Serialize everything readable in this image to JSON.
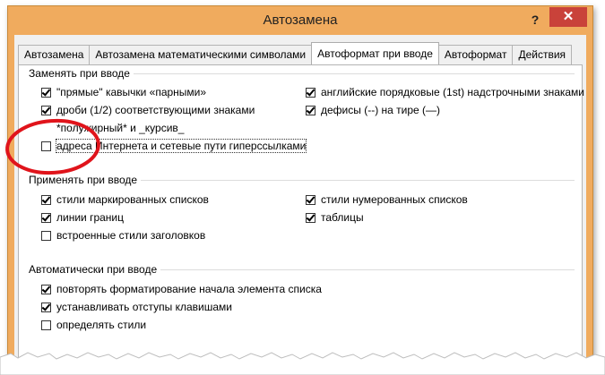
{
  "window": {
    "title": "Автозамена",
    "help": "?",
    "close": "✕"
  },
  "tabs": [
    {
      "label": "Автозамена",
      "active": false
    },
    {
      "label": "Автозамена математическими символами",
      "active": false
    },
    {
      "label": "Автоформат при вводе",
      "active": true
    },
    {
      "label": "Автоформат",
      "active": false
    },
    {
      "label": "Действия",
      "active": false
    }
  ],
  "replace_group": {
    "title": "Заменять при вводе",
    "left": [
      {
        "label": "\"прямые\" кавычки «парными»",
        "checked": true
      },
      {
        "label": "дроби (1/2) соответствующими знаками",
        "checked": true
      },
      {
        "label": "*полужирный* и _курсив_",
        "checked": false
      },
      {
        "label": "адреса Интернета и сетевые пути гиперссылками",
        "checked": false
      }
    ],
    "right": [
      {
        "label": "английские порядковые (1st) надстрочными знаками",
        "checked": true
      },
      {
        "label": "дефисы (--) на тире (—)",
        "checked": true
      }
    ]
  },
  "apply_group": {
    "title": "Применять при вводе",
    "left": [
      {
        "label": "стили маркированных списков",
        "checked": true
      },
      {
        "label": "линии границ",
        "checked": true
      },
      {
        "label": "встроенные стили заголовков",
        "checked": false
      }
    ],
    "right": [
      {
        "label": "стили нумерованных списков",
        "checked": true
      },
      {
        "label": "таблицы",
        "checked": true
      }
    ]
  },
  "auto_group": {
    "title": "Автоматически при вводе",
    "items": [
      {
        "label": "повторять форматирование начала элемента списка",
        "checked": true
      },
      {
        "label": "устанавливать отступы клавишами",
        "checked": true
      },
      {
        "label": "определять стили",
        "checked": false
      }
    ]
  },
  "annotation_color": "#e0141b"
}
